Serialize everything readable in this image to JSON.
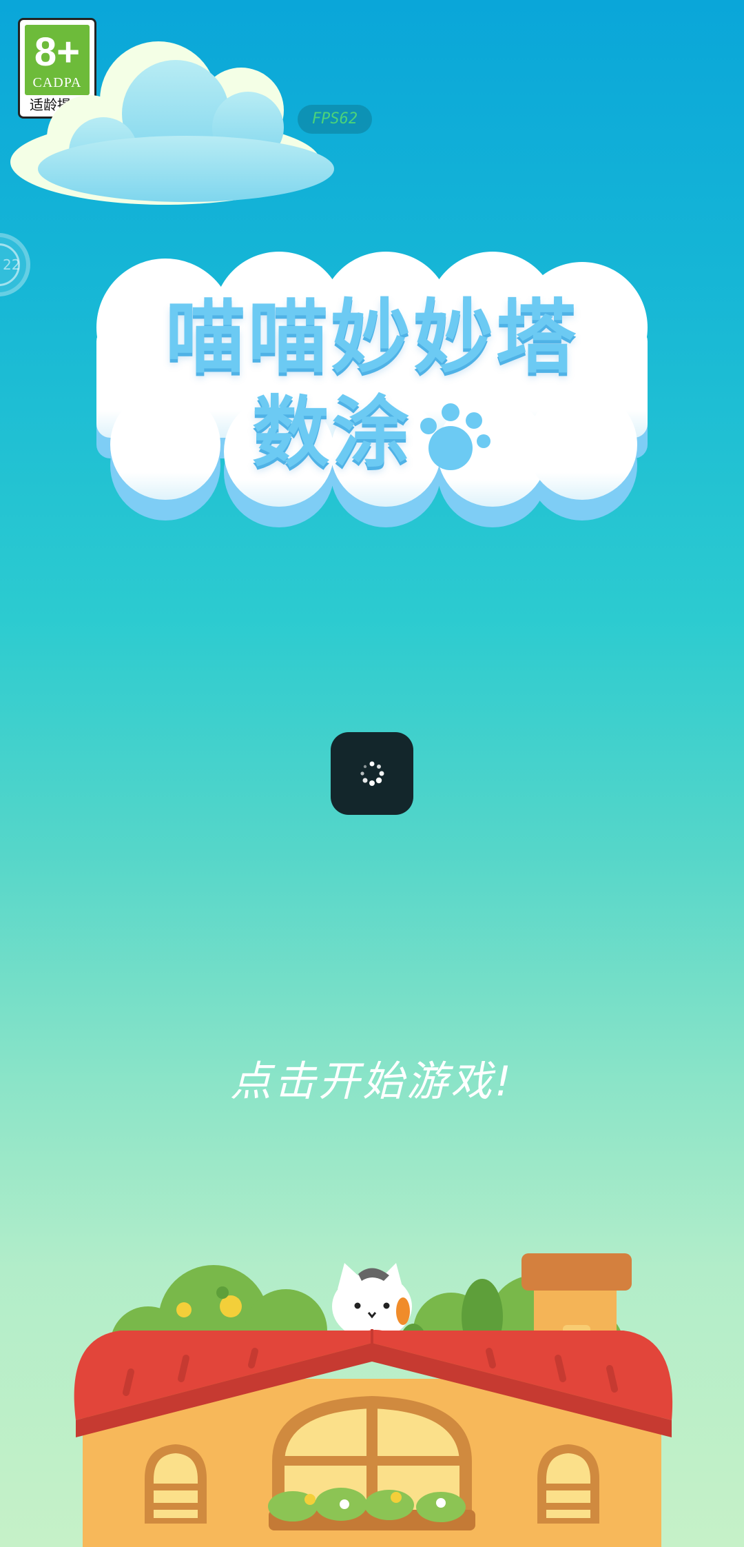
{
  "age_badge": {
    "age": "8+",
    "org": "CADPA",
    "tip": "适龄提示"
  },
  "fps": "FPS62",
  "side_float": {
    "label": "22"
  },
  "title": {
    "line1": "喵喵妙妙塔",
    "line2": "数涂"
  },
  "loading": {
    "state": "loading"
  },
  "start_prompt": "点击开始游戏!",
  "colors": {
    "sky_top": "#0aa6d9",
    "sky_bottom": "#c6f1c8",
    "title_blue": "#6ccaf3",
    "roof_red": "#e2453a",
    "wall_orange": "#f7b85a",
    "badge_green": "#6dbb3a"
  }
}
